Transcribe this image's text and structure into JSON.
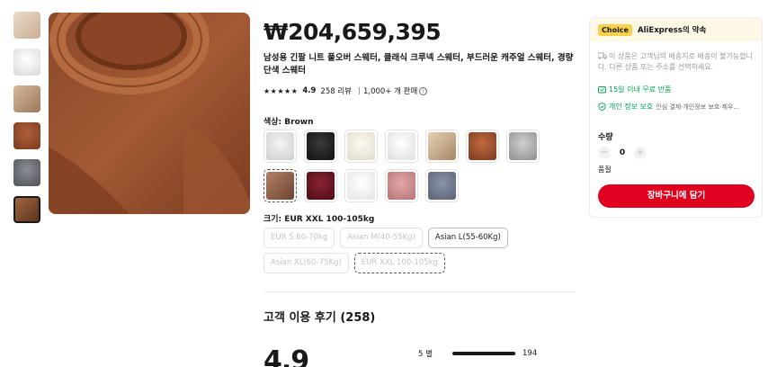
{
  "product": {
    "price": "₩204,659,395",
    "title": "남성용 긴팔 니트 풀오버 스웨터, 클래식 크루넥 스웨터, 부드러운 캐주얼 스웨터, 경량 단색 스웨터",
    "rating": "4.9",
    "reviews_count": "258 리뷰",
    "sold": "1,000+ 개 판매"
  },
  "thumbnails": [
    "beige-sweater",
    "white-sweater",
    "tan-sweater",
    "rust-sweater",
    "gray-sweater",
    "brown-sweater"
  ],
  "color": {
    "label": "색상: Brown",
    "options": [
      "lightgray",
      "black",
      "cream",
      "white",
      "camel",
      "rust",
      "silver",
      "brown",
      "wine",
      "white",
      "pink",
      "slate"
    ],
    "selected_index": 7
  },
  "size": {
    "label": "크기: EUR XXL 100-105kg",
    "options": [
      {
        "label": "EUR S 60-70kg",
        "state": "disabled"
      },
      {
        "label": "Asian M(40-55Kg)",
        "state": "disabled"
      },
      {
        "label": "Asian L(55-60Kg)",
        "state": "available"
      },
      {
        "label": "Asian XL(60-75Kg)",
        "state": "disabled"
      },
      {
        "label": "EUR XXL 100-105kg",
        "state": "selected"
      }
    ]
  },
  "reviews": {
    "title": "고객 이용 후기 (258)",
    "big_rating": "4.9",
    "bar": {
      "label": "5 별",
      "count": "194",
      "fraction": 0.97
    }
  },
  "card": {
    "badge": "Choice",
    "heading": "AliExpress의 약속",
    "shipping_note": "이 상품은 고객님의 배송지로 배송이 불가능합니다. 다른 상품 또는 주소를 선택하세요.",
    "return_text": "15일 이내 무료 반품",
    "privacy_text": "개인 정보 보호",
    "privacy_sub": "안심 결제·개인정보 보호·제우..."
  },
  "quantity": {
    "label": "수량",
    "value": "0",
    "minus": "−",
    "plus": "+",
    "status": "품절"
  },
  "cart_button": "장바구니에 담기",
  "colors": {
    "accent": "#e0001d",
    "green": "#00a650",
    "choice": "#f8d14a"
  }
}
